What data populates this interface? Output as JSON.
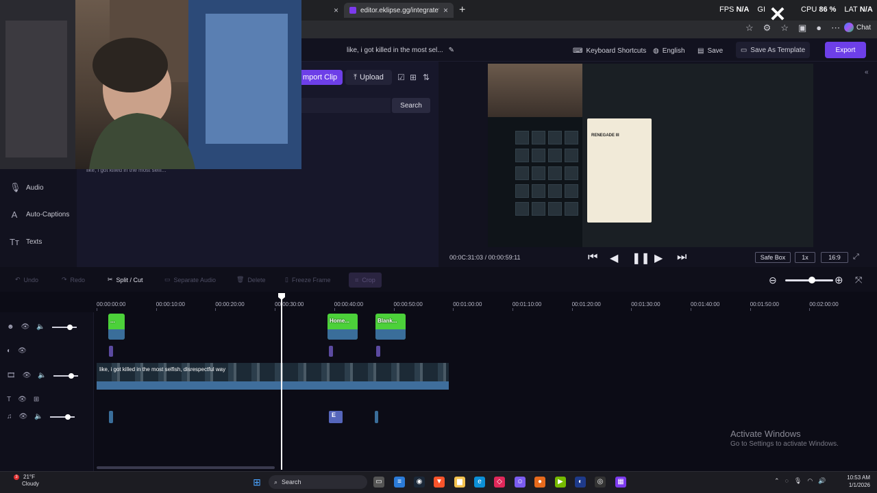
{
  "browser": {
    "prev_tab_close": "×",
    "active_tab_title": "editor.eklipse.gg/integrate?integr",
    "active_tab_close": "×",
    "new_tab": "+",
    "overlay": {
      "fps_label": "FPS",
      "fps_value": "N/A",
      "gpu_label": "GI",
      "cpu_label": "CPU",
      "cpu_value": "86 %",
      "lat_label": "LAT",
      "lat_value": "N/A"
    },
    "chat_label": "Chat"
  },
  "header": {
    "project_title": "like, i got killed in the most sel...",
    "keyboard_shortcuts": "Keyboard Shortcuts",
    "language": "English",
    "save": "Save",
    "save_as_template": "Save As Template",
    "export": "Export"
  },
  "assets": {
    "import_clip": "mport Clip",
    "upload": "Upload",
    "search_button": "Search",
    "caption_preview": "like, i got killed in the most selfi..."
  },
  "sidebar": {
    "items": [
      {
        "label": "Audio",
        "icon": "microphone-icon"
      },
      {
        "label": "Auto-Captions",
        "icon": "caption-a-icon"
      },
      {
        "label": "Texts",
        "icon": "text-tt-icon"
      }
    ]
  },
  "preview": {
    "current_time": "00:0C:31:03",
    "separator": "/",
    "total_time": "00:00:59:11",
    "safe_box": "Safe Box",
    "speed": "1x",
    "aspect": "16:9",
    "game_tooltip_title": "RENEGADE III"
  },
  "timeline_toolbar": {
    "undo": "Undo",
    "redo": "Redo",
    "split_cut": "Split / Cut",
    "separate_audio": "Separate Audio",
    "delete": "Delete",
    "freeze_frame": "Freeze Frame",
    "crop": "Crop"
  },
  "timeline": {
    "ticks": [
      "00:00:00:00",
      "00:00:10:00",
      "00:00:20:00",
      "00:00:30:00",
      "00:00:40:00",
      "00:00:50:00",
      "00:01:00:00",
      "00:01:10:00",
      "00:01:20:00",
      "00:01:30:00",
      "00:01:40:00",
      "00:01:50:00",
      "00:02:00:00"
    ],
    "overlay_clips": [
      {
        "label": "..."
      },
      {
        "label": "Home..."
      },
      {
        "label": "Blank..."
      }
    ],
    "video_clip_text": "like, i got killed in the most selfish, disrespectful way",
    "audio_clip_label": "E"
  },
  "watermark": {
    "title": "Activate Windows",
    "subtitle": "Go to Settings to activate Windows."
  },
  "taskbar": {
    "weather_badge": "3",
    "temperature": "21°F",
    "condition": "Cloudy",
    "search": "Search",
    "time": "10:53 AM",
    "date": "1/1/2026"
  },
  "colors": {
    "accent": "#6d3fe8",
    "clip_green": "#4cd13a",
    "audio_blue": "#3f6e9c",
    "background": "#0f0f1a"
  }
}
